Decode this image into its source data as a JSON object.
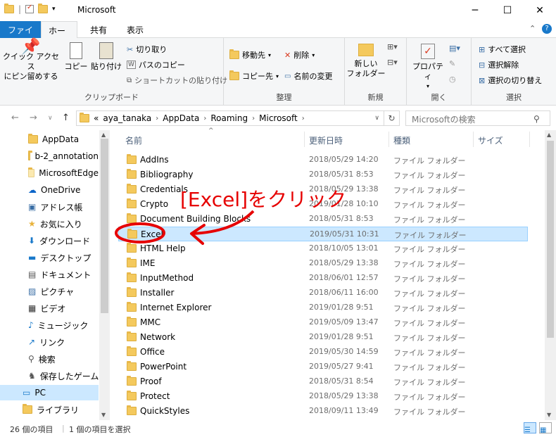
{
  "window": {
    "title": "Microsoft"
  },
  "tabs": {
    "file": "ファイル",
    "home": "ホーム",
    "share": "共有",
    "view": "表示"
  },
  "ribbon": {
    "pin_quick": "クイック アクセス\nにピン留めする",
    "copy": "コピー",
    "paste": "貼り付け",
    "cut": "切り取り",
    "copy_path": "パスのコピー",
    "paste_shortcut": "ショートカットの貼り付け",
    "clipboard_group": "クリップボード",
    "move_to": "移動先",
    "copy_to": "コピー先",
    "delete": "削除",
    "rename": "名前の変更",
    "organize_group": "整理",
    "new_folder": "新しい\nフォルダー",
    "new_group": "新規",
    "properties": "プロパティ",
    "open_group": "開く",
    "select_all": "すべて選択",
    "select_none": "選択解除",
    "invert_selection": "選択の切り替え",
    "select_group": "選択"
  },
  "address": {
    "prefix": "«",
    "segments": [
      "aya_tanaka",
      "AppData",
      "Roaming",
      "Microsoft"
    ],
    "search_placeholder": "Microsoftの検索"
  },
  "columns": {
    "name": "名前",
    "date": "更新日時",
    "type": "種類",
    "size": "サイズ"
  },
  "nav": {
    "items": [
      {
        "label": "AppData",
        "icon": "folder-icon"
      },
      {
        "label": "b-2_annotation",
        "icon": "folder-icon"
      },
      {
        "label": "MicrosoftEdge",
        "icon": "folder-icon"
      },
      {
        "label": "OneDrive",
        "icon": "onedrive-icon"
      },
      {
        "label": "アドレス帳",
        "icon": "contacts-icon"
      },
      {
        "label": "お気に入り",
        "icon": "star-icon"
      },
      {
        "label": "ダウンロード",
        "icon": "download-icon"
      },
      {
        "label": "デスクトップ",
        "icon": "desktop-icon"
      },
      {
        "label": "ドキュメント",
        "icon": "document-icon"
      },
      {
        "label": "ピクチャ",
        "icon": "pictures-icon"
      },
      {
        "label": "ビデオ",
        "icon": "video-icon"
      },
      {
        "label": "ミュージック",
        "icon": "music-icon"
      },
      {
        "label": "リンク",
        "icon": "link-icon"
      },
      {
        "label": "検索",
        "icon": "search-icon"
      },
      {
        "label": "保存したゲーム",
        "icon": "game-icon"
      },
      {
        "label": "PC",
        "icon": "pc-icon"
      },
      {
        "label": "ライブラリ",
        "icon": "library-icon"
      }
    ]
  },
  "files": [
    {
      "name": "AddIns",
      "date": "2018/05/29 14:20",
      "type": "ファイル フォルダー"
    },
    {
      "name": "Bibliography",
      "date": "2018/05/31 8:53",
      "type": "ファイル フォルダー"
    },
    {
      "name": "Credentials",
      "date": "2018/05/29 13:38",
      "type": "ファイル フォルダー"
    },
    {
      "name": "Crypto",
      "date": "2019/01/28 10:10",
      "type": "ファイル フォルダー"
    },
    {
      "name": "Document Building Blocks",
      "date": "2018/05/31 8:53",
      "type": "ファイル フォルダー"
    },
    {
      "name": "Excel",
      "date": "2019/05/31 10:31",
      "type": "ファイル フォルダー"
    },
    {
      "name": "HTML Help",
      "date": "2018/10/05 13:01",
      "type": "ファイル フォルダー"
    },
    {
      "name": "IME",
      "date": "2018/05/29 13:38",
      "type": "ファイル フォルダー"
    },
    {
      "name": "InputMethod",
      "date": "2018/06/01 12:57",
      "type": "ファイル フォルダー"
    },
    {
      "name": "Installer",
      "date": "2018/06/11 16:00",
      "type": "ファイル フォルダー"
    },
    {
      "name": "Internet Explorer",
      "date": "2019/01/28 9:51",
      "type": "ファイル フォルダー"
    },
    {
      "name": "MMC",
      "date": "2019/05/09 13:47",
      "type": "ファイル フォルダー"
    },
    {
      "name": "Network",
      "date": "2019/01/28 9:51",
      "type": "ファイル フォルダー"
    },
    {
      "name": "Office",
      "date": "2019/05/30 14:59",
      "type": "ファイル フォルダー"
    },
    {
      "name": "PowerPoint",
      "date": "2019/05/27 9:41",
      "type": "ファイル フォルダー"
    },
    {
      "name": "Proof",
      "date": "2018/05/31 8:54",
      "type": "ファイル フォルダー"
    },
    {
      "name": "Protect",
      "date": "2018/05/29 13:38",
      "type": "ファイル フォルダー"
    },
    {
      "name": "QuickStyles",
      "date": "2018/09/11 13:49",
      "type": "ファイル フォルダー"
    }
  ],
  "status": {
    "count": "26 個の項目",
    "selected": "1 個の項目を選択"
  },
  "annotation": {
    "text": "[Excel]をクリック",
    "color": "#e60000"
  },
  "colors": {
    "accent": "#1979ca",
    "selection": "#cce8ff",
    "folder": "#f4c95d"
  }
}
